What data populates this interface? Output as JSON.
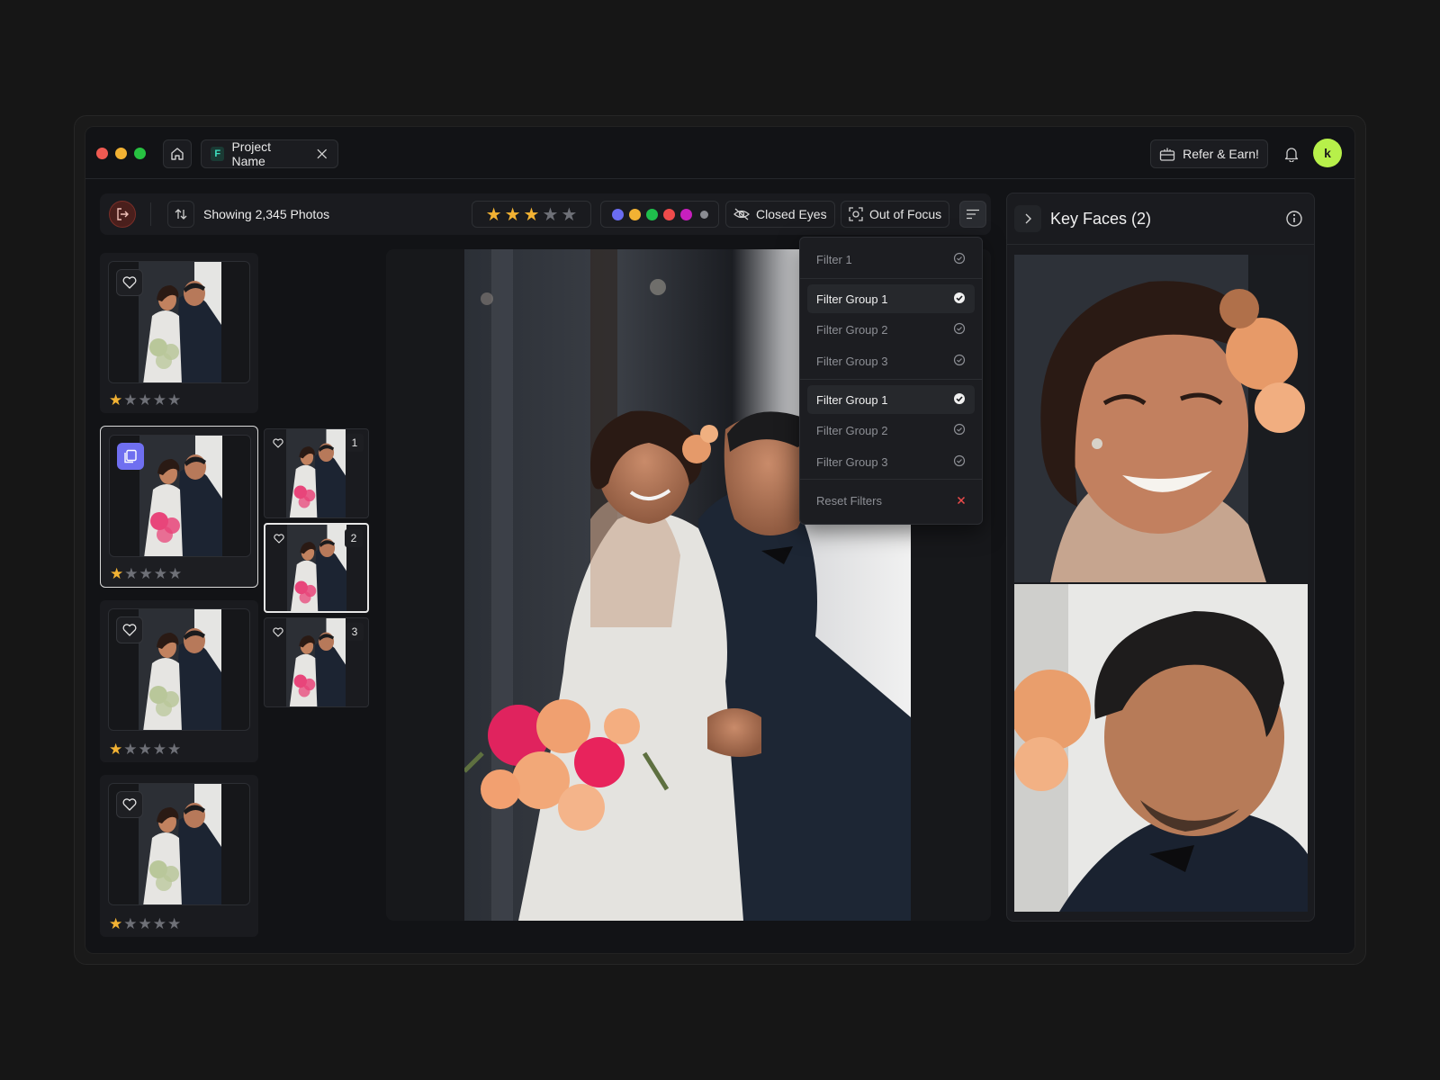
{
  "window": {
    "project_tab": "Project Name",
    "refer_label": "Refer & Earn!",
    "avatar_initial": "k"
  },
  "toolbar": {
    "showing": "Showing 2,345 Photos",
    "rating_filter": 3,
    "color_labels": [
      "#6a6cf0",
      "#f2b233",
      "#1fbf4c",
      "#ef4b4b",
      "#c81fbe",
      "#8a8c92"
    ],
    "closed_eyes": "Closed Eyes",
    "out_of_focus": "Out of Focus"
  },
  "dropdown": {
    "items": [
      {
        "label": "Filter 1",
        "checked": false
      },
      {
        "label": "Filter Group 1",
        "checked": true
      },
      {
        "label": "Filter Group 2",
        "checked": false
      },
      {
        "label": "Filter Group 3",
        "checked": false
      },
      {
        "label": "Filter Group 1",
        "checked": true
      },
      {
        "label": "Filter Group 2",
        "checked": false
      },
      {
        "label": "Filter Group 3",
        "checked": false
      }
    ],
    "reset_label": "Reset Filters"
  },
  "photos": [
    {
      "rating": 1,
      "type": "single"
    },
    {
      "rating": 1,
      "type": "stack"
    },
    {
      "rating": 1,
      "type": "single"
    },
    {
      "rating": 1,
      "type": "single"
    }
  ],
  "stack": [
    {
      "num": "1"
    },
    {
      "num": "2"
    },
    {
      "num": "3"
    }
  ],
  "key_faces": {
    "title": "Key Faces (2)"
  }
}
